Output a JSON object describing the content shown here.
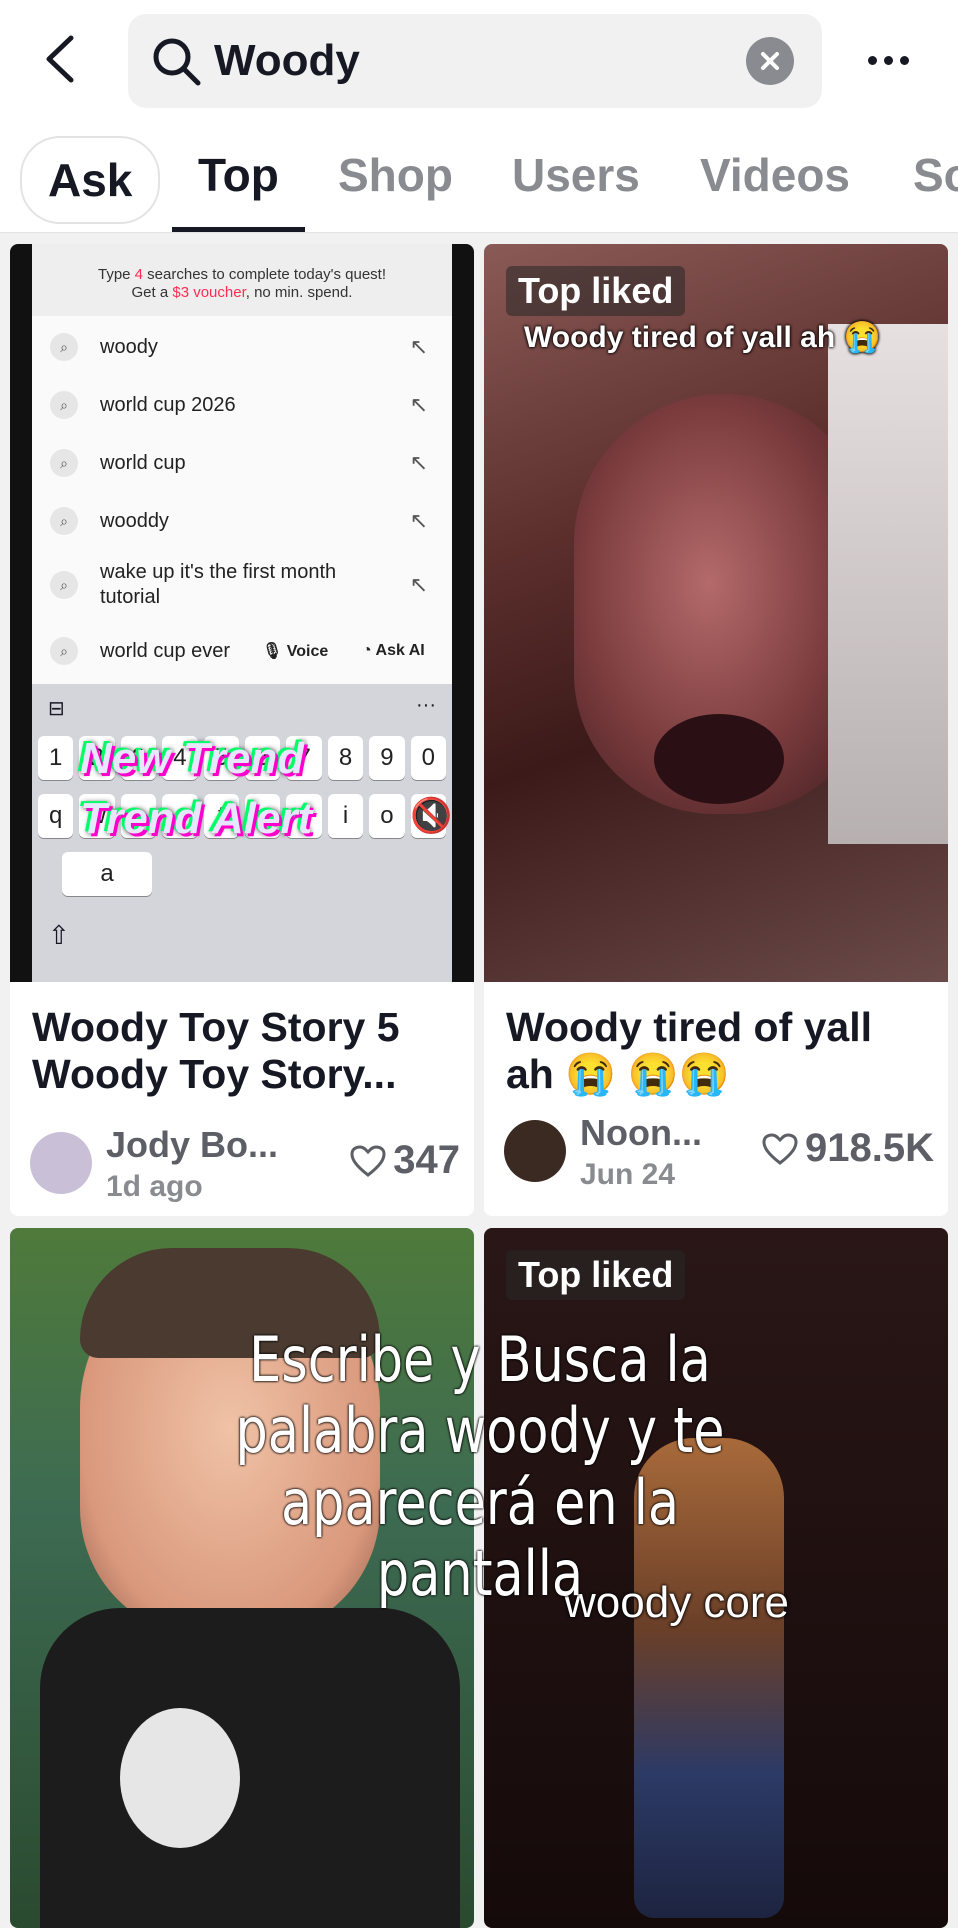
{
  "search": {
    "query": "Woody"
  },
  "tabs": [
    {
      "label": "Ask"
    },
    {
      "label": "Top"
    },
    {
      "label": "Shop"
    },
    {
      "label": "Users"
    },
    {
      "label": "Videos"
    },
    {
      "label": "So"
    }
  ],
  "cards": [
    {
      "title": "Woody Toy Story 5 Woody Toy Story...",
      "author": "Jody Bo...",
      "date": "1d ago",
      "likes": "347",
      "thumb": {
        "quest_line1_a": "Type ",
        "quest_count": "4",
        "quest_line1_b": " searches to complete today's quest!",
        "quest_line2_a": "Get a ",
        "quest_voucher": "$3 voucher",
        "quest_line2_b": ", no min. spend.",
        "suggestions": [
          "woody",
          "world cup 2026",
          "world cup",
          "wooddy",
          "wake up it's the first month tutorial",
          "world cup ever"
        ],
        "voice_label": "Voice",
        "ask_ai_label": "Ask AI",
        "keys_row1": [
          "1",
          "2",
          "3",
          "4",
          "5",
          "6",
          "7",
          "8",
          "9",
          "0"
        ],
        "keys_row2": [
          "q",
          "w",
          "e",
          "r",
          "t",
          "y",
          "u",
          "i",
          "o",
          "p"
        ],
        "key_a": "a",
        "glitch_1": "New Trend",
        "glitch_2": "Trend Alert"
      }
    },
    {
      "badge": "Top liked",
      "caption": "Woody tired of yall ah 😭",
      "title": "Woody tired of yall ah 😭 😭😭",
      "author": "Noon...",
      "date": "Jun 24",
      "likes": "918.5K"
    },
    {
      "caption": "Escribe y Busca la palabra woody y te aparecerá en la pantalla"
    },
    {
      "badge": "Top liked",
      "caption": "woody core"
    }
  ],
  "colors": {
    "accent": "#fe2c55",
    "text": "#161823",
    "muted": "#8a8b91"
  }
}
